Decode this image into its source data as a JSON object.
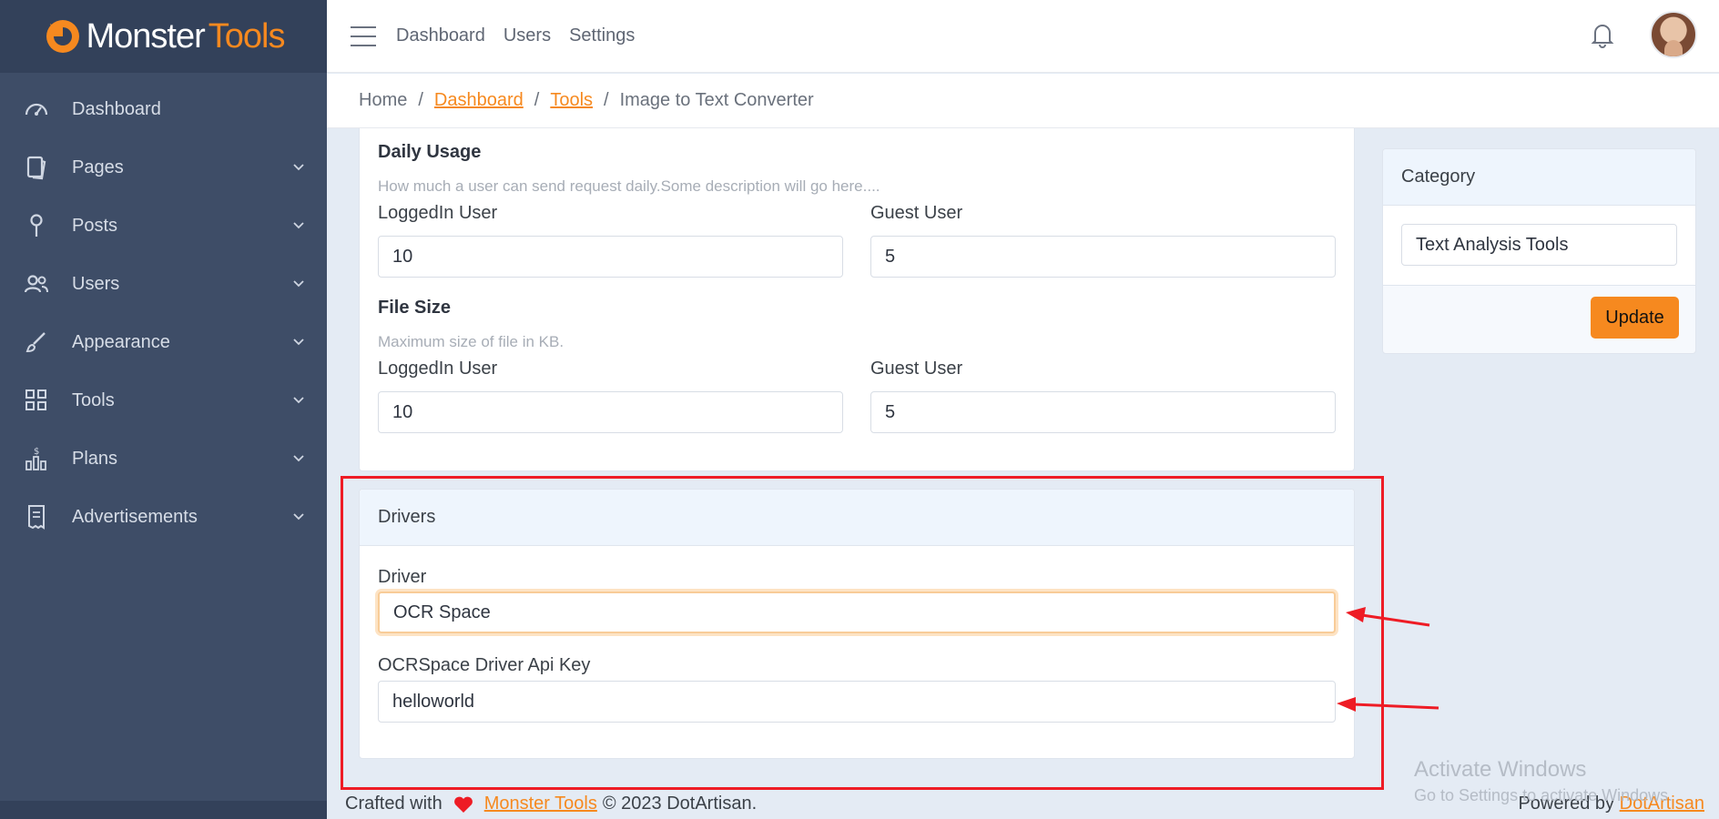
{
  "brand": {
    "part1": "Monster",
    "part2": "Tools"
  },
  "sidebar": {
    "items": [
      {
        "label": "Dashboard",
        "icon": "gauge-icon"
      },
      {
        "label": "Pages",
        "icon": "pages-icon"
      },
      {
        "label": "Posts",
        "icon": "pin-icon"
      },
      {
        "label": "Users",
        "icon": "users-icon"
      },
      {
        "label": "Appearance",
        "icon": "brush-icon"
      },
      {
        "label": "Tools",
        "icon": "grid-icon"
      },
      {
        "label": "Plans",
        "icon": "plans-icon"
      },
      {
        "label": "Advertisements",
        "icon": "receipt-icon"
      }
    ]
  },
  "topbar": {
    "links": [
      "Dashboard",
      "Users",
      "Settings"
    ]
  },
  "breadcrumb": {
    "home": "Home",
    "dashboard": "Dashboard",
    "tools": "Tools",
    "current": "Image to Text Converter"
  },
  "daily_usage": {
    "title": "Daily Usage",
    "description": "How much a user can send request daily.Some description will go here....",
    "logged_label": "LoggedIn User",
    "logged_value": "10",
    "guest_label": "Guest User",
    "guest_value": "5"
  },
  "file_size": {
    "title": "File Size",
    "description": "Maximum size of file in KB.",
    "logged_label": "LoggedIn User",
    "logged_value": "10",
    "guest_label": "Guest User",
    "guest_value": "5"
  },
  "drivers": {
    "header": "Drivers",
    "driver_label": "Driver",
    "driver_value": "OCR Space",
    "api_key_label": "OCRSpace Driver Api Key",
    "api_key_value": "helloworld"
  },
  "category": {
    "header": "Category",
    "value": "Text Analysis Tools",
    "update_button": "Update"
  },
  "footer": {
    "crafted": "Crafted with",
    "brand_link": "Monster Tools",
    "copyright": "© 2023 DotArtisan.",
    "powered": "Powered by",
    "powered_link": "DotArtisan"
  },
  "watermark": {
    "line1": "Activate Windows",
    "line2": "Go to Settings to activate Windows."
  },
  "colors": {
    "accent": "#f6891f",
    "sidebar": "#3e4d67",
    "highlight": "#ee1c25"
  }
}
